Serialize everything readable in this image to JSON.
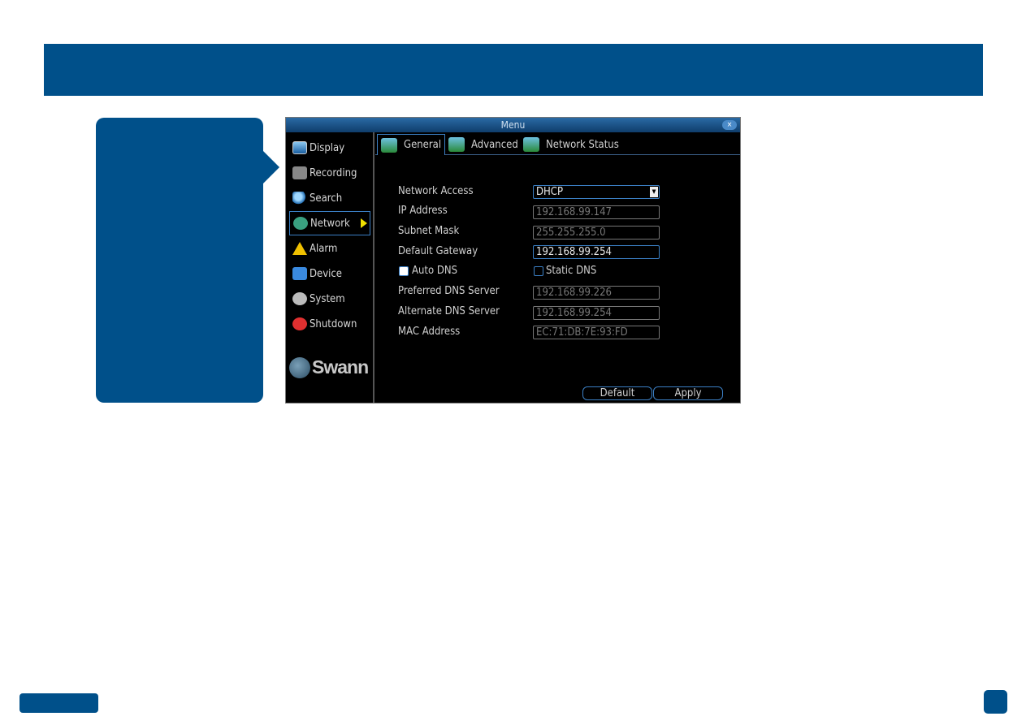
{
  "window": {
    "title": "Menu",
    "close": "×"
  },
  "menu": [
    {
      "label": "Display",
      "icon": "display-icon"
    },
    {
      "label": "Recording",
      "icon": "recording-icon"
    },
    {
      "label": "Search",
      "icon": "search-icon"
    },
    {
      "label": "Network",
      "icon": "network-icon",
      "active": true
    },
    {
      "label": "Alarm",
      "icon": "alarm-icon"
    },
    {
      "label": "Device",
      "icon": "device-icon"
    },
    {
      "label": "System",
      "icon": "gear-icon"
    },
    {
      "label": "Shutdown",
      "icon": "power-icon"
    }
  ],
  "logo": "Swann",
  "tabs": [
    {
      "label": "General"
    },
    {
      "label": "Advanced"
    },
    {
      "label": "Network Status"
    }
  ],
  "form": {
    "network_access": {
      "label": "Network Access",
      "value": "DHCP"
    },
    "ip": {
      "label": "IP Address",
      "value": "192.168.99.147"
    },
    "subnet": {
      "label": "Subnet Mask",
      "value": "255.255.255.0"
    },
    "gateway": {
      "label": "Default Gateway",
      "value": "192.168.99.254"
    },
    "auto_dns": {
      "label": "Auto DNS",
      "checked": true
    },
    "static_dns": {
      "label": "Static DNS",
      "checked": false
    },
    "pref_dns": {
      "label": "Preferred DNS Server",
      "value": "192.168.99.226"
    },
    "alt_dns": {
      "label": "Alternate DNS Server",
      "value": "192.168.99.254"
    },
    "mac": {
      "label": "MAC Address",
      "value": "EC:71:DB:7E:93:FD"
    }
  },
  "buttons": {
    "default": "Default",
    "apply": "Apply"
  },
  "colors": {
    "brand": "#00508a",
    "accent": "#3b7fc4"
  }
}
